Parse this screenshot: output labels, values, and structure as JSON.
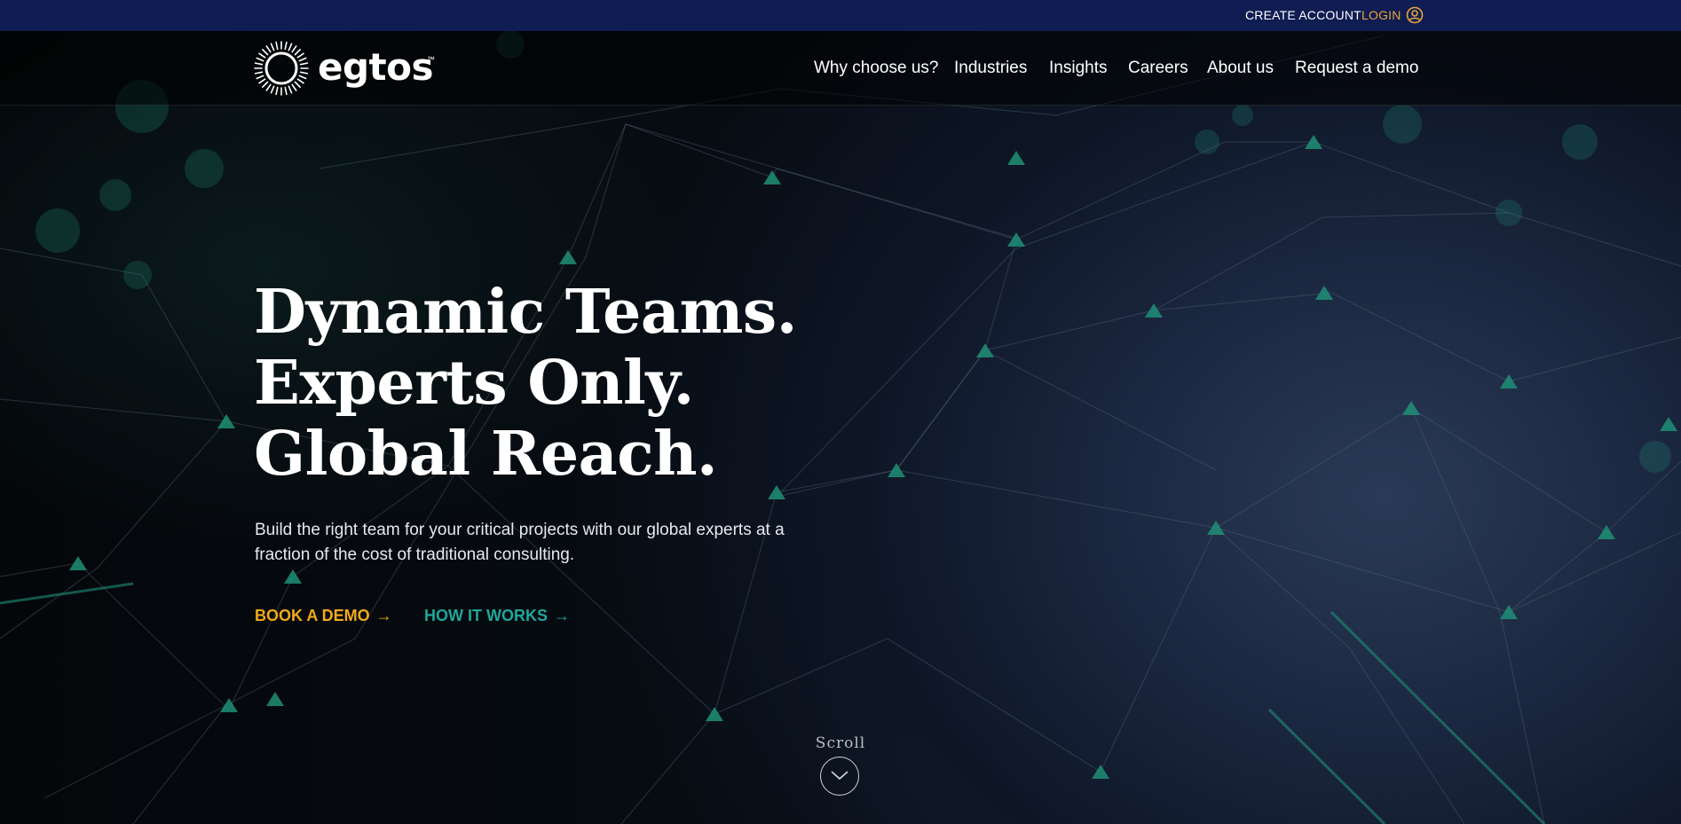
{
  "topbar": {
    "create_account": "CREATE ACCOUNT",
    "login": "LOGIN"
  },
  "brand": {
    "name": "egtos",
    "trademark": "™"
  },
  "nav": {
    "items": [
      "Why choose us?",
      "Industries",
      "Insights",
      "Careers",
      "About us",
      "Request a demo"
    ]
  },
  "hero": {
    "headline": [
      "Dynamic Teams.",
      "Experts Only.",
      "Global Reach."
    ],
    "subtext": "Build the right team for your critical projects with our global experts at a fraction of the cost of traditional consulting.",
    "cta_primary": "BOOK A DEMO",
    "cta_secondary": "HOW IT WORKS",
    "scroll_label": "Scroll"
  },
  "icons": {
    "login": "user-circle-icon",
    "cta_arrow": "arrow-right-icon",
    "scroll": "chevron-down-icon",
    "logo": "sunburst-ring-logo"
  },
  "colors": {
    "topbar_bg": "#0f1d52",
    "login_accent": "#e9a43a",
    "cta_primary": "#f2a91c",
    "cta_secondary": "#1fa79b",
    "network_green": "#1e8f76",
    "background": "#05080d"
  }
}
